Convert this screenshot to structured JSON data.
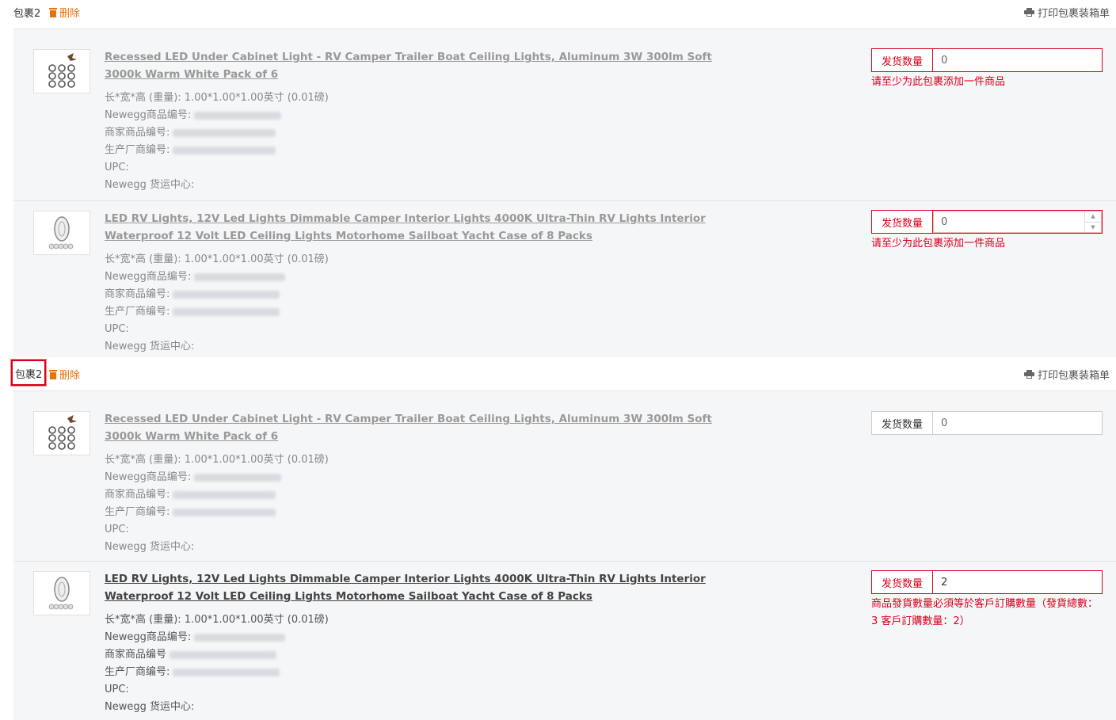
{
  "packages": [
    {
      "title": "包裹2",
      "delete_label": "删除",
      "print_label": "打印包裹装箱单",
      "items": [
        {
          "title": "Recessed LED Under Cabinet Light - RV Camper Trailer Boat Ceiling Lights, Aluminum 3W 300lm Soft 3000k Warm White Pack of 6",
          "dims": "长*宽*高 (重量): 1.00*1.00*1.00英寸 (0.01磅)",
          "newegg_item_label": "Newegg商品编号:",
          "seller_item_label": "商家商品编号:",
          "mfr_item_label": "生产厂商编号:",
          "upc_label": "UPC:",
          "center_label": "Newegg 货运中心:",
          "qty_label": "发货数量",
          "qty_value": "0",
          "error": "请至少为此包裹添加一件商品"
        },
        {
          "title": "LED RV Lights, 12V Led Lights Dimmable Camper Interior Lights 4000K Ultra-Thin RV Lights Interior Waterproof 12 Volt LED Ceiling Lights Motorhome Sailboat Yacht Case of 8 Packs",
          "dims": "长*宽*高 (重量): 1.00*1.00*1.00英寸 (0.01磅)",
          "newegg_item_label": "Newegg商品编号:",
          "seller_item_label": "商家商品编号:",
          "mfr_item_label": "生产厂商编号:",
          "upc_label": "UPC:",
          "center_label": "Newegg 货运中心:",
          "qty_label": "发货数量",
          "qty_value": "0",
          "error": "请至少为此包裹添加一件商品"
        }
      ]
    },
    {
      "title": "包裹2",
      "delete_label": "删除",
      "print_label": "打印包裹装箱单",
      "items": [
        {
          "title": "Recessed LED Under Cabinet Light - RV Camper Trailer Boat Ceiling Lights, Aluminum 3W 300lm Soft 3000k Warm White Pack of 6",
          "dims": "长*宽*高 (重量): 1.00*1.00*1.00英寸 (0.01磅)",
          "newegg_item_label": "Newegg商品编号:",
          "seller_item_label": "商家商品编号:",
          "mfr_item_label": "生产厂商编号:",
          "upc_label": "UPC:",
          "center_label": "Newegg 货运中心:",
          "qty_label": "发货数量",
          "qty_value": "0"
        },
        {
          "title": "LED RV Lights, 12V Led Lights Dimmable Camper Interior Lights 4000K Ultra-Thin RV Lights Interior Waterproof 12 Volt LED Ceiling Lights Motorhome Sailboat Yacht Case of 8 Packs",
          "dims": "长*宽*高 (重量): 1.00*1.00*1.00英寸 (0.01磅)",
          "newegg_item_label": "Newegg商品编号:",
          "seller_item_label": "商家商品编号",
          "mfr_item_label": "生产厂商编号:",
          "upc_label": "UPC:",
          "center_label": "Newegg 货运中心:",
          "qty_label": "发货数量",
          "qty_value": "2",
          "error": "商品發貨數量必須等於客戶訂購數量（發貨總數：3 客戶訂購數量：2）"
        }
      ]
    }
  ],
  "colors": {
    "error": "#d9001b",
    "delete": "#e8710a",
    "panel_bg": "#f5f6f8"
  }
}
